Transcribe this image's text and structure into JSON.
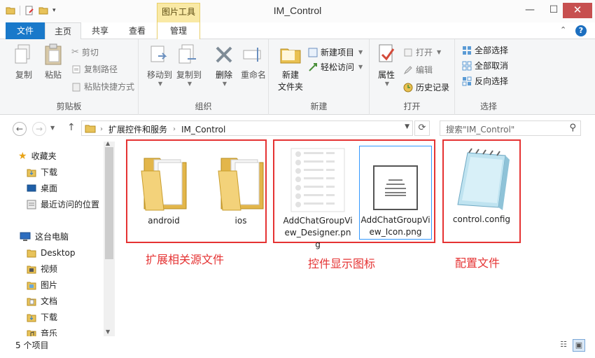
{
  "window": {
    "title": "IM_Control",
    "context_tab_title": "图片工具",
    "controls": {
      "minimize": "—",
      "maximize": "☐",
      "close": "✕"
    }
  },
  "tabs": {
    "file": "文件",
    "home": "主页",
    "share": "共享",
    "view": "查看",
    "manage": "管理",
    "help": "?"
  },
  "ribbon": {
    "clipboard": {
      "label": "剪贴板",
      "copy": "复制",
      "paste": "粘贴",
      "cut": "剪切",
      "copy_path": "复制路径",
      "paste_shortcut": "粘贴快捷方式"
    },
    "organize": {
      "label": "组织",
      "move_to": "移动到",
      "copy_to": "复制到",
      "delete": "删除",
      "rename": "重命名"
    },
    "new": {
      "label": "新建",
      "new_folder_line1": "新建",
      "new_folder_line2": "文件夹",
      "new_item": "新建项目",
      "easy_access": "轻松访问"
    },
    "open": {
      "label": "打开",
      "properties": "属性",
      "open": "打开",
      "edit": "编辑",
      "history": "历史记录"
    },
    "select": {
      "label": "选择",
      "select_all": "全部选择",
      "select_none": "全部取消",
      "invert": "反向选择"
    }
  },
  "address": {
    "crumbs": [
      "扩展控件和服务",
      "IM_Control"
    ],
    "search_placeholder": "搜索\"IM_Control\""
  },
  "nav": {
    "favorites": "收藏夹",
    "downloads": "下载",
    "desktop": "桌面",
    "recent": "最近访问的位置",
    "this_pc": "这台电脑",
    "desktop_en": "Desktop",
    "videos": "视频",
    "pictures": "图片",
    "documents": "文档",
    "downloads2": "下载",
    "music": "音乐"
  },
  "files": {
    "android": "android",
    "ios": "ios",
    "designer_png": "AddChatGroupView_Designer.png",
    "icon_png": "AddChatGroupView_Icon.png",
    "config": "control.config"
  },
  "annotations": {
    "extension_source": "扩展相关源文件",
    "control_icons": "控件显示图标",
    "config_file": "配置文件"
  },
  "status": {
    "count": "5 个项目"
  },
  "colors": {
    "accent": "#1979ca",
    "annotation_red": "#e53333",
    "context_tab": "#f9e9a5",
    "close_button": "#c75050"
  }
}
